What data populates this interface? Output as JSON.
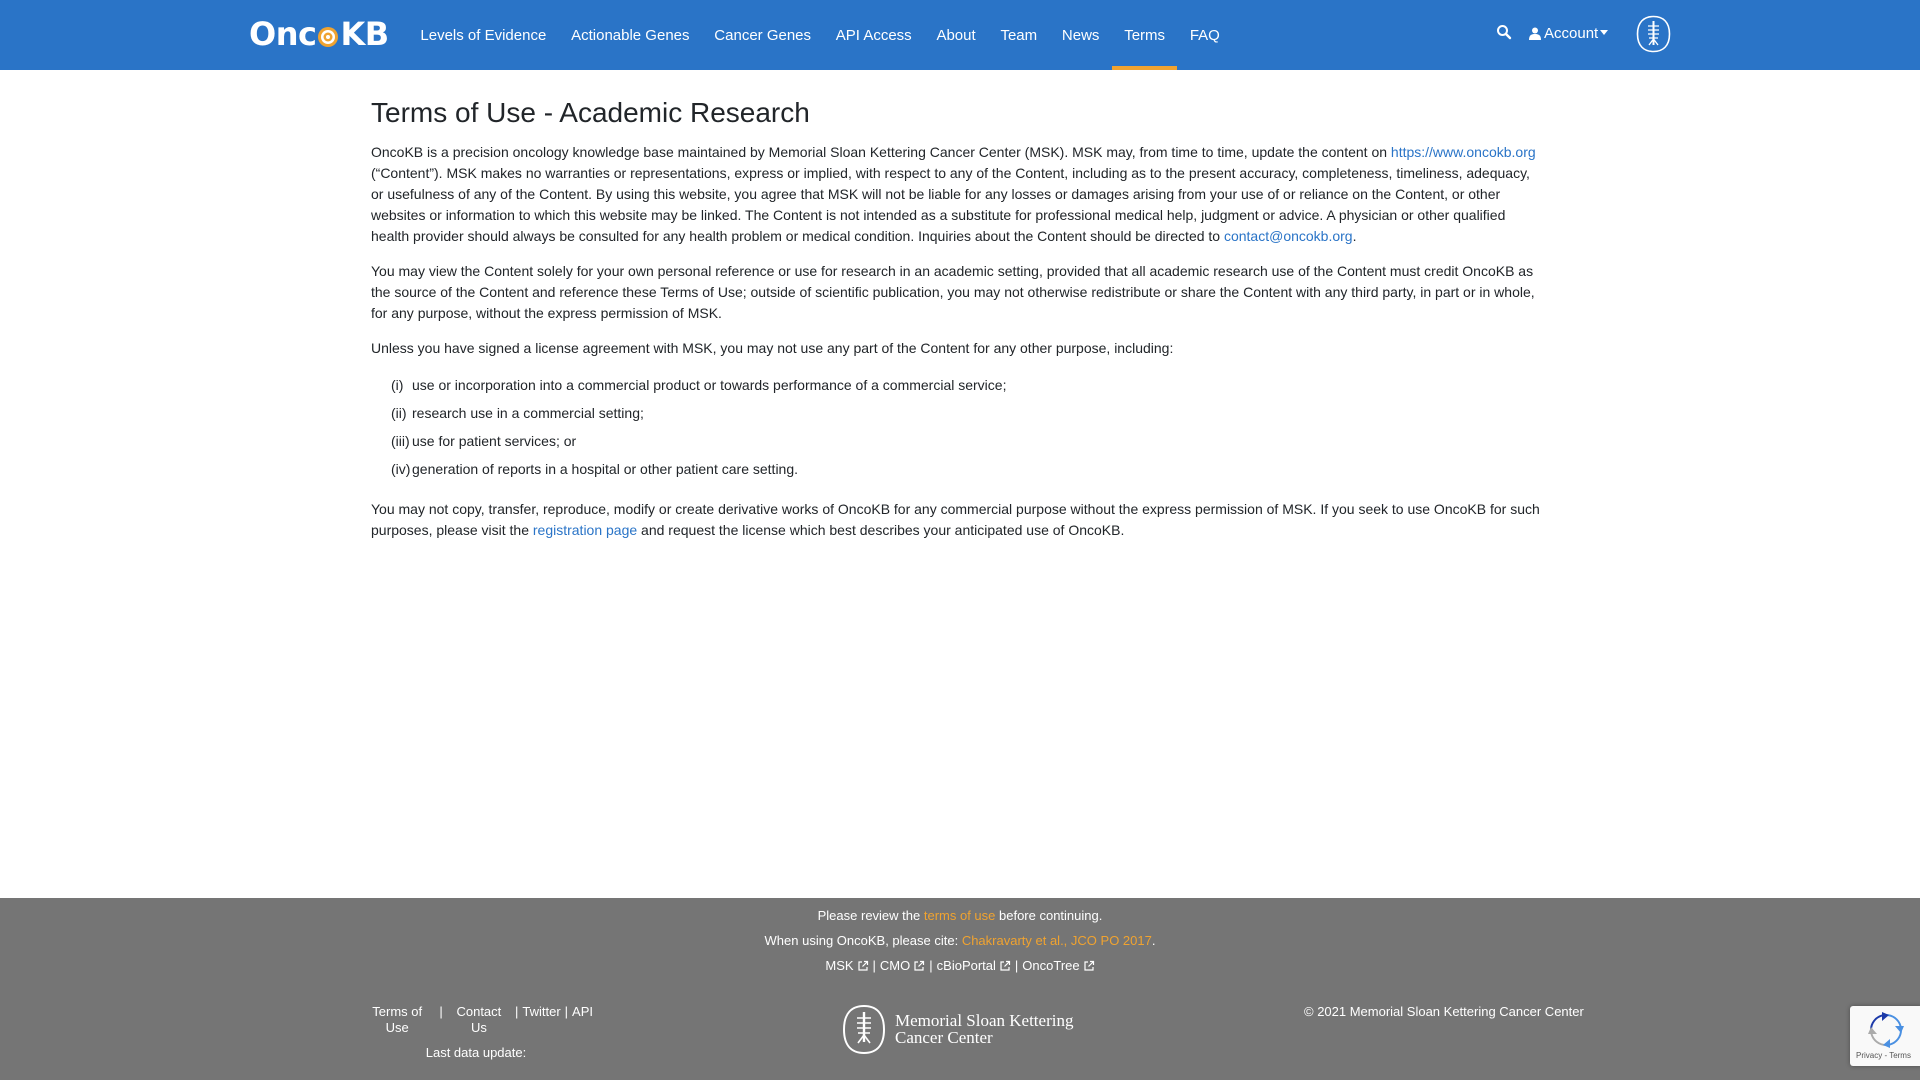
{
  "navbar": {
    "brand": {
      "text_pre": "Onc",
      "text_post": "KB"
    },
    "items": [
      {
        "label": "Levels of Evidence",
        "active": false
      },
      {
        "label": "Actionable Genes",
        "active": false
      },
      {
        "label": "Cancer Genes",
        "active": false
      },
      {
        "label": "API Access",
        "active": false
      },
      {
        "label": "About",
        "active": false
      },
      {
        "label": "Team",
        "active": false
      },
      {
        "label": "News",
        "active": false
      },
      {
        "label": "Terms",
        "active": true
      },
      {
        "label": "FAQ",
        "active": false
      }
    ],
    "search_icon": "search-icon",
    "account_label": "Account",
    "msk_icon": "msk-logo-icon"
  },
  "main": {
    "title": "Terms of Use - Academic Research",
    "p1": {
      "a": "OncoKB is a precision oncology knowledge base maintained by Memorial Sloan Kettering Cancer Center (MSK). MSK may, from time to time, update the content on",
      "link": "https://www.oncokb.org",
      "b": " (“Content”). MSK makes no warranties or representations, express or implied, with respect to any of the Content, including as to the present accuracy, completeness, timeliness, adequacy, or usefulness of any of the Content. By using this website, you agree that MSK will not be liable for any losses or damages arising from your use of or reliance on the Content, or other websites or information to which this website may be linked. The Content is not intended as a substitute for professional medical help, judgment or advice. A physician or other qualified health provider should always be consulted for any health problem or medical condition. Inquiries about the Content should be directed to",
      "email": "contact@oncokb.org",
      "c": "."
    },
    "p2": "You may view the Content solely for your own personal reference or use for research in an academic setting, provided that all academic research use of the Content must credit OncoKB as the source of the Content and reference these Terms of Use; outside of scientific publication, you may not otherwise redistribute or share the Content with any third party, in part or in whole, for any purpose, without the express permission of MSK.",
    "p3": "Unless you have signed a license agreement with MSK, you may not use any part of the Content for any other purpose, including:",
    "list": [
      {
        "num": "(i)",
        "text": "use or incorporation into a commercial product or towards performance of a commercial service;"
      },
      {
        "num": "(ii)",
        "text": "research use in a commercial setting;"
      },
      {
        "num": "(iii)",
        "text": "use for patient services; or"
      },
      {
        "num": "(iv)",
        "text": "generation of reports in a hospital or other patient care setting."
      }
    ],
    "p4": {
      "a": "You may not copy, transfer, reproduce, modify or create derivative works of OncoKB for any commercial purpose without the express permission of MSK. If you seek to use OncoKB for such purposes, please visit the ",
      "link": "registration page",
      "b": " and request the license which best describes your anticipated use of OncoKB."
    }
  },
  "footer": {
    "review": {
      "a": "Please review the ",
      "link": "terms of use",
      "b": " before continuing."
    },
    "cite": {
      "a": "When using OncoKB, please cite: ",
      "link": "Chakravarty et al., JCO PO 2017",
      "b": "."
    },
    "external_links": [
      "MSK",
      "CMO",
      "cBioPortal",
      "OncoTree"
    ],
    "left_links": [
      "Terms of Use",
      "Contact Us",
      "Twitter",
      "API"
    ],
    "last_update_label": "Last data update:",
    "logo_line1": "Memorial Sloan Kettering",
    "logo_line2": "Cancer Center",
    "copyright": "© 2021 Memorial Sloan Kettering Cancer Center",
    "separator": "|"
  },
  "recaptcha": {
    "text": "Privacy - Terms"
  },
  "colors": {
    "navbar": "#2a74c7",
    "accent": "#f0a330",
    "footer": "#757575",
    "link": "#2a74c7"
  }
}
